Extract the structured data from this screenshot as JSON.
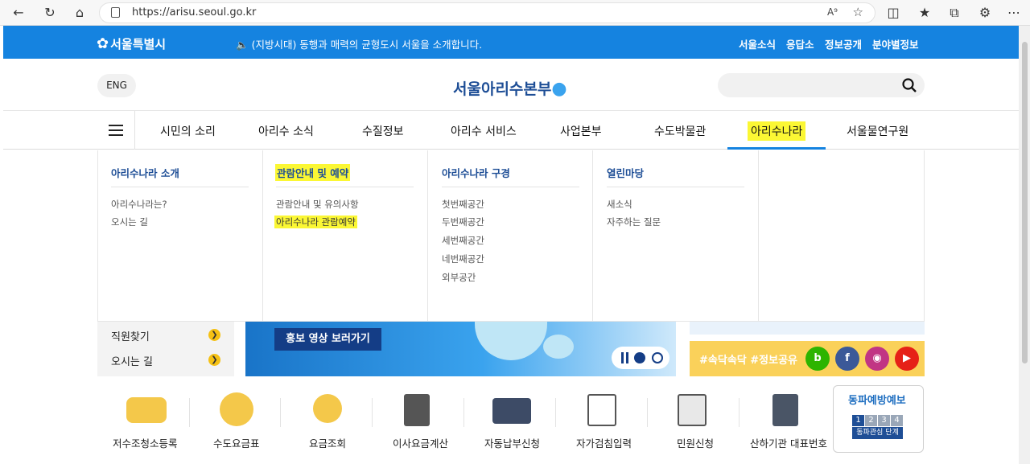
{
  "browser": {
    "url": "https://arisu.seoul.go.kr"
  },
  "topbar": {
    "logo": "서울특별시",
    "notice": "(지방시대) 동행과 매력의 균형도시 서울을 소개합니다.",
    "menu": [
      "서울소식",
      "응답소",
      "정보공개",
      "분야별정보"
    ]
  },
  "header": {
    "eng_label": "ENG",
    "brand": "서울아리수본부"
  },
  "gnb": {
    "items": [
      "시민의 소리",
      "아리수 소식",
      "수질정보",
      "아리수 서비스",
      "사업본부",
      "수도박물관",
      "아리수나라",
      "서울물연구원"
    ],
    "active_index": 6
  },
  "mega": {
    "columns": [
      {
        "title": "아리수나라 소개",
        "links": [
          "아리수나라는?",
          "오시는 길"
        ]
      },
      {
        "title": "관람안내 및 예약",
        "links": [
          "관람안내 및 유의사항",
          "아리수나라 관람예약"
        ]
      },
      {
        "title": "아리수나라 구경",
        "links": [
          "첫번째공간",
          "두번째공간",
          "세번째공간",
          "네번째공간",
          "외부공간"
        ]
      },
      {
        "title": "열린마당",
        "links": [
          "새소식",
          "자주하는 질문"
        ]
      }
    ]
  },
  "quicklinks": [
    "직원찾기",
    "오시는 길"
  ],
  "banner": {
    "button": "홍보 영상 보러가기"
  },
  "sns": {
    "text": "#속닥속닥 #정보공유",
    "icons": [
      "blog-icon",
      "facebook-icon",
      "instagram-icon",
      "youtube-icon"
    ],
    "colors": [
      "#2db400",
      "#3b5998",
      "#c13584",
      "#e62117"
    ]
  },
  "services": [
    "저수조청소등록",
    "수도요금표",
    "요금조회",
    "이사요금계산",
    "자동납부신청",
    "자가검침입력",
    "민원신청",
    "산하기관 대표번호"
  ],
  "forecast": {
    "title": "동파예방예보",
    "levels": [
      "1",
      "2",
      "3",
      "4"
    ],
    "stage": "동파관심 단계"
  },
  "colors": {
    "primary": "#1583e0",
    "navy": "#1e4e96",
    "highlight": "#fbf734"
  }
}
